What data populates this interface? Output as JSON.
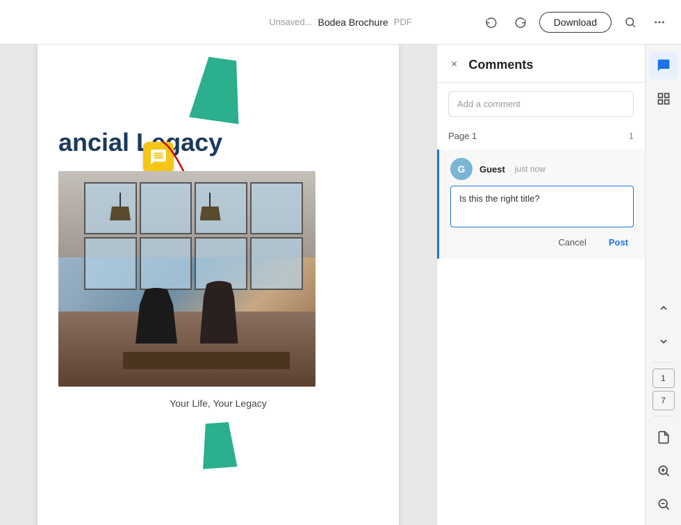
{
  "topbar": {
    "unsaved_label": "Unsaved...",
    "doc_title": "Bodea Brochure",
    "doc_type": "PDF",
    "download_label": "Download",
    "undo_icon": "↩",
    "redo_icon": "↪",
    "search_icon": "⌕",
    "more_icon": "⋯"
  },
  "pdf": {
    "page_title": "ancial Legacy",
    "subtitle": "Your Life, Your Legacy"
  },
  "comments": {
    "panel_title": "Comments",
    "add_placeholder": "Add a comment",
    "close_icon": "×",
    "page_section_label": "Page 1",
    "page_section_count": "1",
    "comment": {
      "user_initial": "G",
      "user_name": "Guest",
      "time": "just now",
      "text": "Is this the right title?",
      "cancel_label": "Cancel",
      "post_label": "Post"
    }
  },
  "right_sidebar": {
    "comment_icon": "💬",
    "grid_icon": "⊞",
    "chevron_up": "⌃",
    "chevron_down": "⌄",
    "page1_label": "1",
    "page7_label": "7",
    "doc_icon": "📄",
    "zoom_in_icon": "+",
    "zoom_out_icon": "−"
  }
}
